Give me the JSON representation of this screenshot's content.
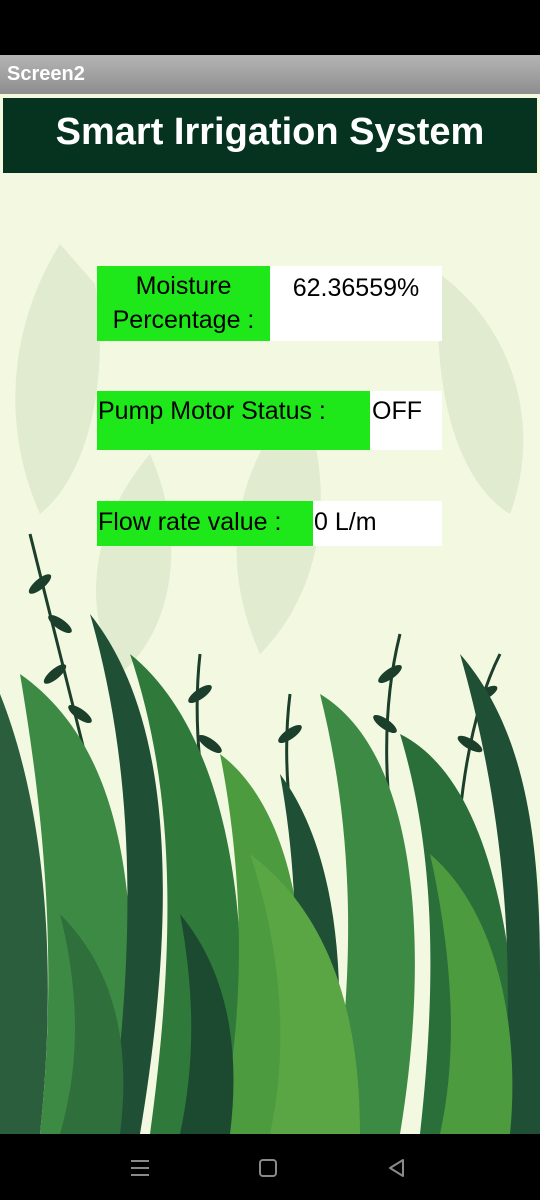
{
  "window": {
    "title": "Screen2"
  },
  "header": {
    "title": "Smart Irrigation System"
  },
  "readings": {
    "moisture": {
      "label": "Moisture Percentage :",
      "value": "62.36559%"
    },
    "pump": {
      "label": "Pump Motor Status :",
      "value": "OFF"
    },
    "flow": {
      "label": "Flow rate value :",
      "value": "0 L/m"
    }
  },
  "nav": {
    "recents_icon": "menu-lines-icon",
    "home_icon": "square-home-icon",
    "back_icon": "triangle-back-icon"
  },
  "colors": {
    "header_bg": "#053320",
    "label_bg": "#1ee81a",
    "background": "#f3f9e1",
    "leaf_dark": "#1f4f35",
    "leaf_mid": "#2f7a3a",
    "leaf_light": "#5aa645"
  }
}
